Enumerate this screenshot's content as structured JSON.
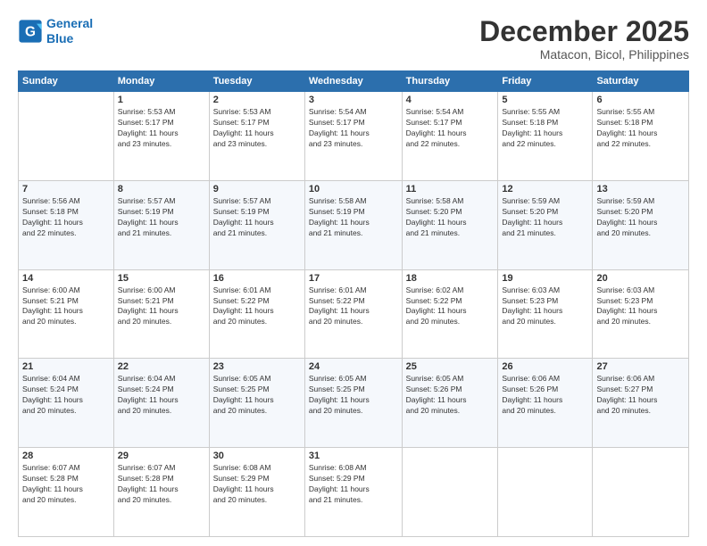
{
  "header": {
    "logo_line1": "General",
    "logo_line2": "Blue",
    "month": "December 2025",
    "location": "Matacon, Bicol, Philippines"
  },
  "weekdays": [
    "Sunday",
    "Monday",
    "Tuesday",
    "Wednesday",
    "Thursday",
    "Friday",
    "Saturday"
  ],
  "weeks": [
    [
      {
        "day": "",
        "info": ""
      },
      {
        "day": "1",
        "info": "Sunrise: 5:53 AM\nSunset: 5:17 PM\nDaylight: 11 hours\nand 23 minutes."
      },
      {
        "day": "2",
        "info": "Sunrise: 5:53 AM\nSunset: 5:17 PM\nDaylight: 11 hours\nand 23 minutes."
      },
      {
        "day": "3",
        "info": "Sunrise: 5:54 AM\nSunset: 5:17 PM\nDaylight: 11 hours\nand 23 minutes."
      },
      {
        "day": "4",
        "info": "Sunrise: 5:54 AM\nSunset: 5:17 PM\nDaylight: 11 hours\nand 22 minutes."
      },
      {
        "day": "5",
        "info": "Sunrise: 5:55 AM\nSunset: 5:18 PM\nDaylight: 11 hours\nand 22 minutes."
      },
      {
        "day": "6",
        "info": "Sunrise: 5:55 AM\nSunset: 5:18 PM\nDaylight: 11 hours\nand 22 minutes."
      }
    ],
    [
      {
        "day": "7",
        "info": "Sunrise: 5:56 AM\nSunset: 5:18 PM\nDaylight: 11 hours\nand 22 minutes."
      },
      {
        "day": "8",
        "info": "Sunrise: 5:57 AM\nSunset: 5:19 PM\nDaylight: 11 hours\nand 21 minutes."
      },
      {
        "day": "9",
        "info": "Sunrise: 5:57 AM\nSunset: 5:19 PM\nDaylight: 11 hours\nand 21 minutes."
      },
      {
        "day": "10",
        "info": "Sunrise: 5:58 AM\nSunset: 5:19 PM\nDaylight: 11 hours\nand 21 minutes."
      },
      {
        "day": "11",
        "info": "Sunrise: 5:58 AM\nSunset: 5:20 PM\nDaylight: 11 hours\nand 21 minutes."
      },
      {
        "day": "12",
        "info": "Sunrise: 5:59 AM\nSunset: 5:20 PM\nDaylight: 11 hours\nand 21 minutes."
      },
      {
        "day": "13",
        "info": "Sunrise: 5:59 AM\nSunset: 5:20 PM\nDaylight: 11 hours\nand 20 minutes."
      }
    ],
    [
      {
        "day": "14",
        "info": "Sunrise: 6:00 AM\nSunset: 5:21 PM\nDaylight: 11 hours\nand 20 minutes."
      },
      {
        "day": "15",
        "info": "Sunrise: 6:00 AM\nSunset: 5:21 PM\nDaylight: 11 hours\nand 20 minutes."
      },
      {
        "day": "16",
        "info": "Sunrise: 6:01 AM\nSunset: 5:22 PM\nDaylight: 11 hours\nand 20 minutes."
      },
      {
        "day": "17",
        "info": "Sunrise: 6:01 AM\nSunset: 5:22 PM\nDaylight: 11 hours\nand 20 minutes."
      },
      {
        "day": "18",
        "info": "Sunrise: 6:02 AM\nSunset: 5:22 PM\nDaylight: 11 hours\nand 20 minutes."
      },
      {
        "day": "19",
        "info": "Sunrise: 6:03 AM\nSunset: 5:23 PM\nDaylight: 11 hours\nand 20 minutes."
      },
      {
        "day": "20",
        "info": "Sunrise: 6:03 AM\nSunset: 5:23 PM\nDaylight: 11 hours\nand 20 minutes."
      }
    ],
    [
      {
        "day": "21",
        "info": "Sunrise: 6:04 AM\nSunset: 5:24 PM\nDaylight: 11 hours\nand 20 minutes."
      },
      {
        "day": "22",
        "info": "Sunrise: 6:04 AM\nSunset: 5:24 PM\nDaylight: 11 hours\nand 20 minutes."
      },
      {
        "day": "23",
        "info": "Sunrise: 6:05 AM\nSunset: 5:25 PM\nDaylight: 11 hours\nand 20 minutes."
      },
      {
        "day": "24",
        "info": "Sunrise: 6:05 AM\nSunset: 5:25 PM\nDaylight: 11 hours\nand 20 minutes."
      },
      {
        "day": "25",
        "info": "Sunrise: 6:05 AM\nSunset: 5:26 PM\nDaylight: 11 hours\nand 20 minutes."
      },
      {
        "day": "26",
        "info": "Sunrise: 6:06 AM\nSunset: 5:26 PM\nDaylight: 11 hours\nand 20 minutes."
      },
      {
        "day": "27",
        "info": "Sunrise: 6:06 AM\nSunset: 5:27 PM\nDaylight: 11 hours\nand 20 minutes."
      }
    ],
    [
      {
        "day": "28",
        "info": "Sunrise: 6:07 AM\nSunset: 5:28 PM\nDaylight: 11 hours\nand 20 minutes."
      },
      {
        "day": "29",
        "info": "Sunrise: 6:07 AM\nSunset: 5:28 PM\nDaylight: 11 hours\nand 20 minutes."
      },
      {
        "day": "30",
        "info": "Sunrise: 6:08 AM\nSunset: 5:29 PM\nDaylight: 11 hours\nand 20 minutes."
      },
      {
        "day": "31",
        "info": "Sunrise: 6:08 AM\nSunset: 5:29 PM\nDaylight: 11 hours\nand 21 minutes."
      },
      {
        "day": "",
        "info": ""
      },
      {
        "day": "",
        "info": ""
      },
      {
        "day": "",
        "info": ""
      }
    ]
  ]
}
